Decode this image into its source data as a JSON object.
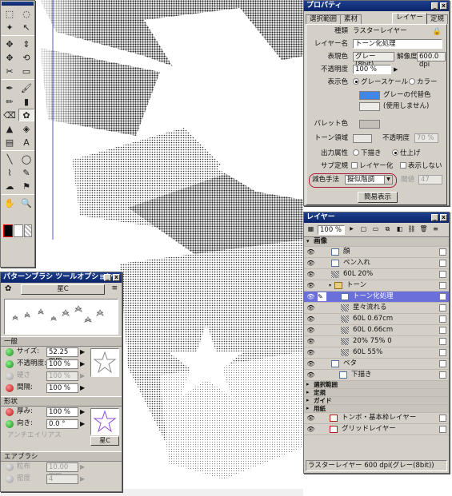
{
  "properties": {
    "title": "プロパティ",
    "tabs": [
      "選択範囲",
      "素材",
      "レイヤー",
      "定規"
    ],
    "fields": {
      "kind_label": "種類",
      "kind_value": "ラスターレイヤー",
      "name_label": "レイヤー名",
      "name_value": "トーン化処理",
      "expr_label": "表現色",
      "expr_value": "グレー(8bit)",
      "res_label": "解像度",
      "res_value": "600.0 dpi",
      "opacity_label": "不透明度",
      "opacity_value": "100 %",
      "display_label": "表示色",
      "display_gray": "グレースケール",
      "display_color": "カラー",
      "gray_sub_label": "グレーの代替色",
      "unused_label": "(使用しません)",
      "palette_label": "パレット色",
      "tone_area_label": "トーン領域",
      "tone_opacity_label": "不透明度",
      "tone_opacity_value": "70 %",
      "output_label": "出力属性",
      "output_sketch": "下描き",
      "output_finish": "仕上げ",
      "sub_ruler_label": "サブ定規",
      "sub_ruler_layer": "レイヤー化",
      "sub_ruler_hide": "表示しない",
      "reduce_label": "減色手法",
      "reduce_value": "擬似階調",
      "threshold_label": "閾値",
      "threshold_value": "47",
      "simple_display": "簡易表示"
    },
    "colors": {
      "gray_sub": "#3f86e8",
      "highlight_ring": "#b0183a"
    }
  },
  "layers": {
    "title": "レイヤー",
    "zoom": "100 %",
    "rows": [
      {
        "name": "画像",
        "type": "group-header"
      },
      {
        "name": "顔",
        "type": "raster"
      },
      {
        "name": "ペン入れ",
        "type": "raster"
      },
      {
        "name": "60L 20%",
        "type": "tone"
      },
      {
        "name": "トーン",
        "type": "folder"
      },
      {
        "name": "トーン化処理",
        "type": "raster-selected"
      },
      {
        "name": "星々流れる",
        "type": "tone"
      },
      {
        "name": "60L 0.67cm",
        "type": "tone"
      },
      {
        "name": "60L 0.66cm",
        "type": "tone"
      },
      {
        "name": "20% 75% 0",
        "type": "tone"
      },
      {
        "name": "60L 55%",
        "type": "tone"
      },
      {
        "name": "ベタ",
        "type": "raster"
      },
      {
        "name": "下描き",
        "type": "raster-sketch"
      },
      {
        "name": "選択範囲",
        "type": "group-header"
      },
      {
        "name": "定規",
        "type": "group-header"
      },
      {
        "name": "ガイド",
        "type": "group-header"
      },
      {
        "name": "用紙",
        "type": "group-header"
      },
      {
        "name": "トンボ・基本枠レイヤー",
        "type": "special"
      },
      {
        "name": "グリッドレイヤー",
        "type": "special"
      }
    ],
    "status": "ラスターレイヤー 600 dpi(グレー(8bit))"
  },
  "brush": {
    "title": "パターンブラシ ツールオプション",
    "brush_name": "星C",
    "preview_label": "星C",
    "sections": {
      "general": "一般",
      "shape": "形状",
      "airbrush": "エアブラシ"
    },
    "general_rows": [
      {
        "label": "サイズ:",
        "value": "52.25 mm",
        "enabled": true,
        "ball": "green"
      },
      {
        "label": "不透明度:",
        "value": "100 %",
        "enabled": true,
        "ball": "green"
      },
      {
        "label": "硬さ",
        "value": "100 %",
        "enabled": false,
        "ball": "gray"
      },
      {
        "label": "間隔:",
        "value": "100 %",
        "enabled": true,
        "ball": "red"
      }
    ],
    "shape_rows": [
      {
        "label": "厚み:",
        "value": "100 %",
        "enabled": true,
        "ball": "red"
      },
      {
        "label": "向き:",
        "value": "0.0 °",
        "enabled": true,
        "ball": "green"
      }
    ],
    "antialias": "アンチエイリアス",
    "air_rows": [
      {
        "label": "粒布",
        "value": "10.00 mm",
        "enabled": false,
        "ball": "gray"
      },
      {
        "label": "密度",
        "value": "4",
        "enabled": false,
        "ball": "gray"
      }
    ]
  },
  "tools": {
    "icons": [
      "select-rect",
      "lasso",
      "magic-wand",
      "select-pen",
      "hand-move",
      "layer-move",
      "move",
      "rotate",
      "cut",
      "ruler",
      "pen",
      "brush",
      "pencil",
      "marker",
      "eraser",
      "pattern-brush",
      "fill",
      "tone-fill",
      "gradation",
      "text",
      "line",
      "curve",
      "polyline",
      "correction",
      "smudge",
      "stamp",
      "hand",
      "zoom"
    ],
    "glyphs": [
      "⬚",
      "◌",
      "✦",
      "↖",
      "✥",
      "⇕",
      "✥",
      "⟲",
      "✂",
      "▭",
      "✒",
      "🖌",
      "✏",
      "▮",
      "⌫",
      "✿",
      "▲",
      "◈",
      "▤",
      "A",
      "╲",
      "◯",
      "⌇",
      "✎",
      "☁",
      "⚑",
      "✋",
      "🔍"
    ],
    "foreground": "#000000",
    "background": "#ffffff",
    "accent": "#ff0000"
  }
}
